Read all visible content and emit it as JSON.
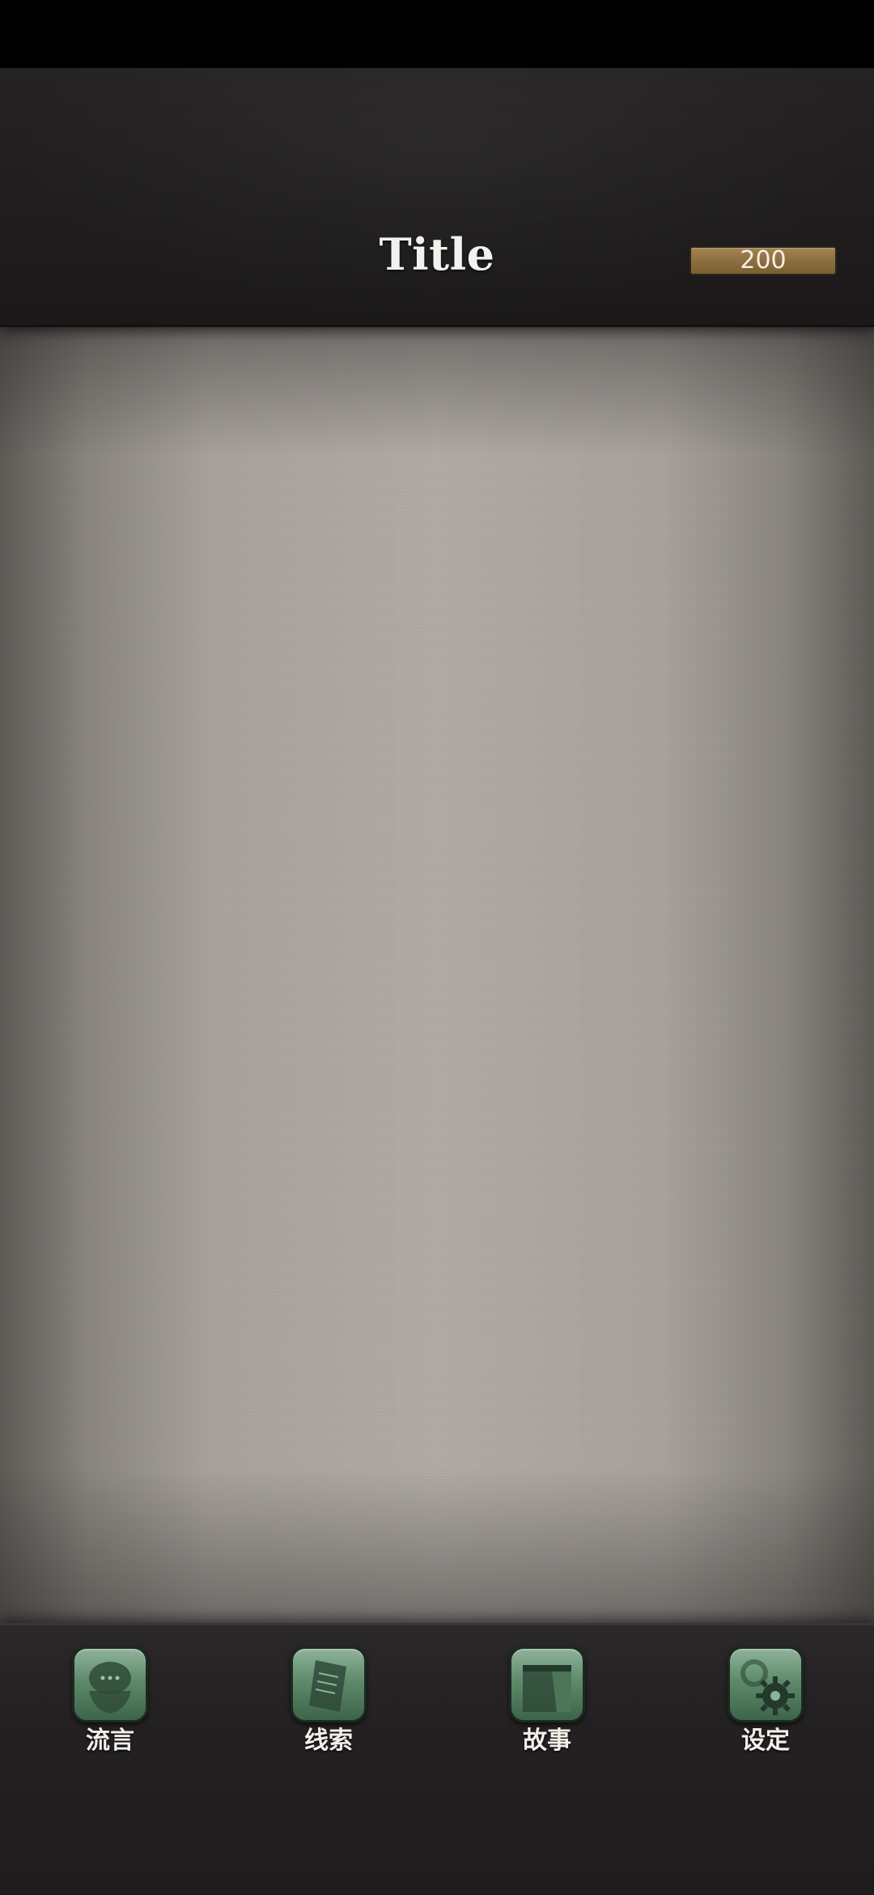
{
  "header": {
    "title": "Title",
    "counter_value": "200"
  },
  "tabs": [
    {
      "label": "流言",
      "icon": "speech-bubble-icon"
    },
    {
      "label": "线索",
      "icon": "paper-note-icon"
    },
    {
      "label": "故事",
      "icon": "book-icon"
    },
    {
      "label": "设定",
      "icon": "gear-icon"
    }
  ],
  "colors": {
    "header_bg": "#1f1d1e",
    "tab_icon_green": "#5e8a6b",
    "counter_gold": "#8c6c40",
    "parchment": "#b1aba6"
  }
}
